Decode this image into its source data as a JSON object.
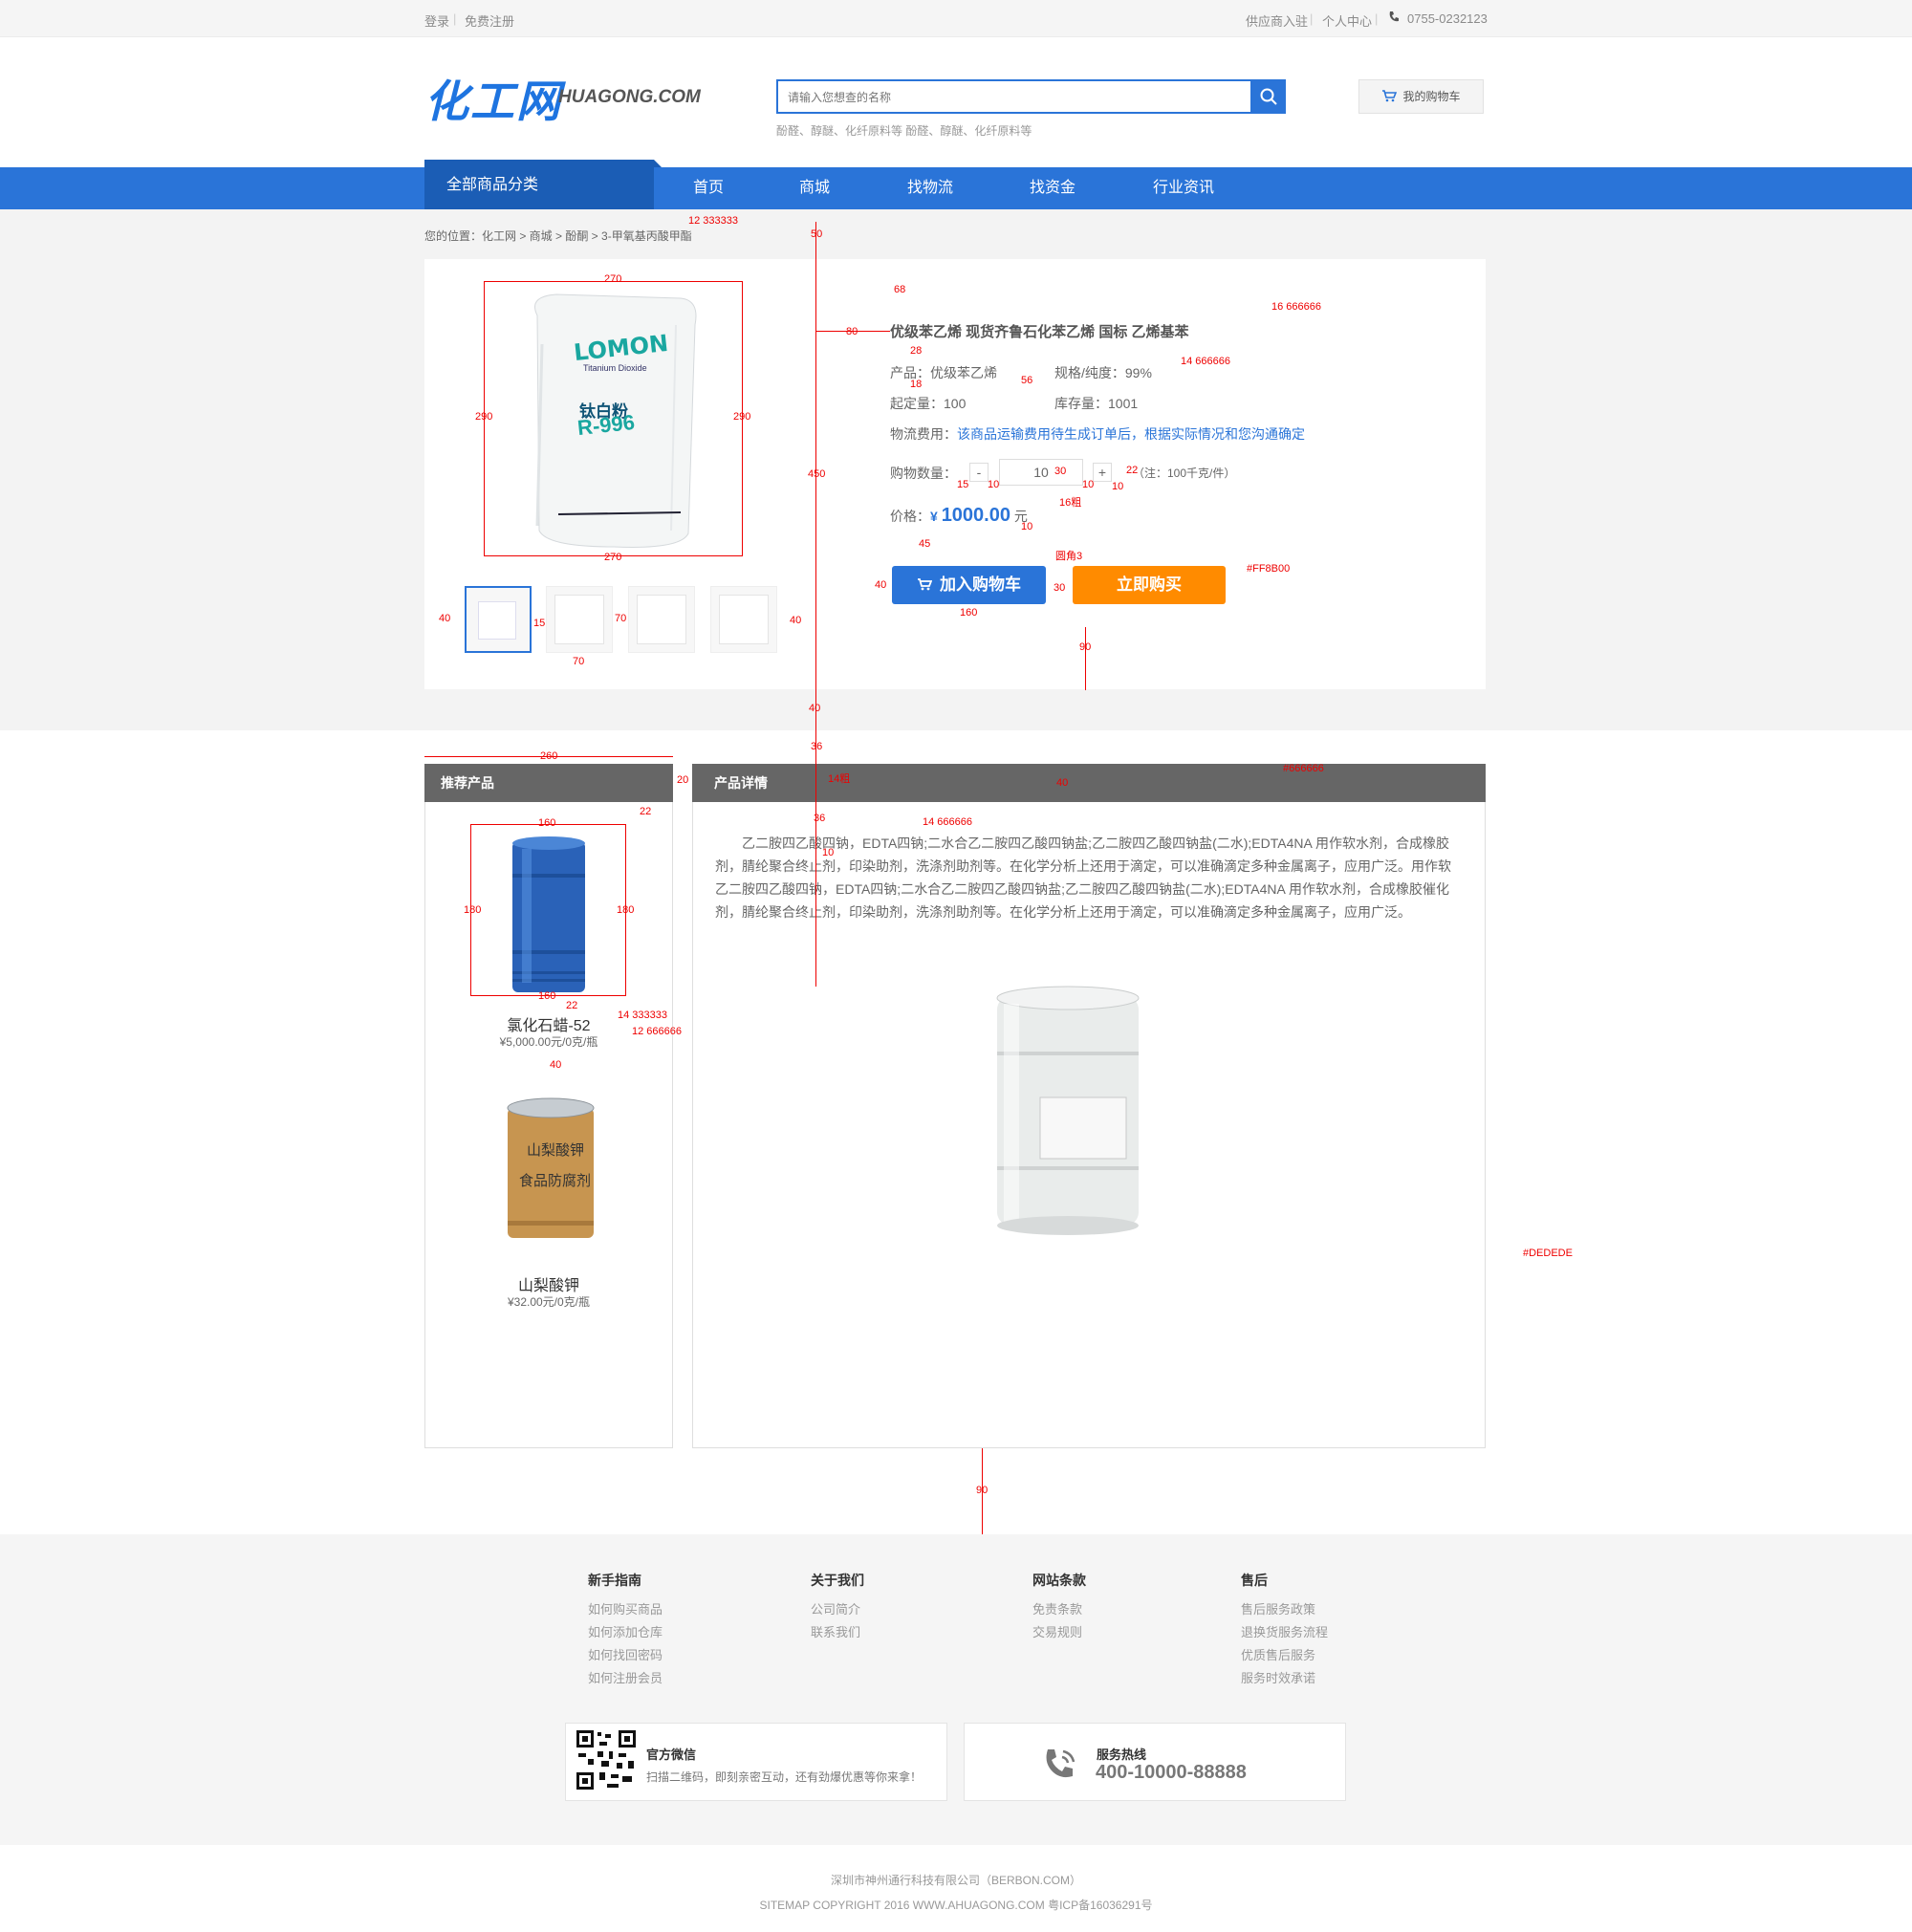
{
  "topbar": {
    "login": "登录",
    "register": "免费注册",
    "supplier": "供应商入驻",
    "personal": "个人中心",
    "phone": "0755-0232123"
  },
  "header": {
    "logo_cn": "化工网",
    "logo_en": "HUAGONG.COM",
    "search_placeholder": "请输入您想查的名称",
    "hotwords": "酚醛、醇醚、化纤原料等  酚醛、醇醚、化纤原料等",
    "cart_label": "我的购物车"
  },
  "nav": {
    "all_categories": "全部商品分类",
    "items": [
      "首页",
      "商城",
      "找物流",
      "找资金",
      "行业资讯"
    ]
  },
  "breadcrumb": "您的位置：化工网 > 商城 > 酚酮 > 3-甲氧基丙酸甲酯",
  "product": {
    "image_brand": "LOMON",
    "image_sub": "Titanium Dioxide",
    "image_cn": "钛白粉",
    "image_model": "R-996",
    "title": "优级苯乙烯 现货齐鲁石化苯乙烯 国标 乙烯基苯",
    "name_label": "产品：优级苯乙烯",
    "spec_label": "规格/纯度：99%",
    "min_label": "起定量：100",
    "stock_label": "库存量：1001",
    "shipping_label": "物流费用：",
    "shipping_text": "该商品运输费用待生成订单后，根据实际情况和您沟通确定",
    "qty_label": "购物数量：",
    "qty_minus": "-",
    "qty_value": "10",
    "qty_plus": "+",
    "qty_note": "（注：100千克/件）",
    "price_label": "价格：",
    "price_symbol": "¥",
    "price_value": "1000.00",
    "price_unit": "元",
    "add_cart": "加入购物车",
    "buy_now": "立即购买"
  },
  "sidebar": {
    "title": "推荐产品",
    "items": [
      {
        "name": "氯化石蜡-52",
        "price": "¥5,000.00元/0克/瓶"
      },
      {
        "name": "山梨酸钾",
        "price": "¥32.00元/0克/瓶",
        "label1": "山梨酸钾",
        "label2": "食品防腐剂"
      }
    ]
  },
  "detail": {
    "title": "产品详情",
    "text": "乙二胺四乙酸四钠，EDTA四钠;二水合乙二胺四乙酸四钠盐;乙二胺四乙酸四钠盐(二水);EDTA4NA 用作软水剂，合成橡胶剂，腈纶聚合终止剂，印染助剂，洗涤剂助剂等。在化学分析上还用于滴定，可以准确滴定多种金属离子，应用广泛。用作软乙二胺四乙酸四钠，EDTA四钠;二水合乙二胺四乙酸四钠盐;乙二胺四乙酸四钠盐(二水);EDTA4NA 用作软水剂，合成橡胶催化剂，腈纶聚合终止剂，印染助剂，洗涤剂助剂等。在化学分析上还用于滴定，可以准确滴定多种金属离子，应用广泛。"
  },
  "footer": {
    "columns": [
      {
        "title": "新手指南",
        "links": [
          "如何购买商品",
          "如何添加仓库",
          "如何找回密码",
          "如何注册会员"
        ]
      },
      {
        "title": "关于我们",
        "links": [
          "公司简介",
          "联系我们"
        ]
      },
      {
        "title": "网站条款",
        "links": [
          "免责条款",
          "交易规则"
        ]
      },
      {
        "title": "售后",
        "links": [
          "售后服务政策",
          "退换货服务流程",
          "优质售后服务",
          "服务时效承诺"
        ]
      }
    ],
    "wechat_title": "官方微信",
    "wechat_text": "扫描二维码，即刻亲密互动，还有劲爆优惠等你来拿！",
    "hotline_title": "服务热线",
    "hotline_number": "400-10000-88888",
    "company": "深圳市神州通行科技有限公司（BERBON.COM）",
    "copyright": "SITEMAP COPYRIGHT 2016 WWW.AHUAGONG.COM 粤ICP备16036291号"
  },
  "annotations": {
    "a1": "12  333333",
    "a2": "16  666666",
    "a3": "14  666666",
    "a4": "16粗",
    "a5": "圆角3",
    "a6": "#FF8B00",
    "a7": "14粗",
    "a8": "#666666",
    "a9": "14  666666",
    "a10": "14  333333",
    "a11": "12  666666",
    "a12": "#DEDEDE",
    "n270": "270",
    "n290": "290",
    "n80": "80",
    "n68": "68",
    "n28": "28",
    "n18": "18",
    "n56": "56",
    "n450": "450",
    "n50": "50",
    "n40": "40",
    "n70": "70",
    "n15": "15",
    "n10": "10",
    "n30": "30",
    "n45": "45",
    "n160": "160",
    "n90": "90",
    "n36": "36",
    "n260": "260",
    "n20": "20",
    "n22": "22",
    "n180": "180"
  },
  "colors": {
    "brand_blue": "#2a74d8",
    "buy_orange": "#ff8b00",
    "head_gray": "#666666",
    "border": "#dedede"
  }
}
